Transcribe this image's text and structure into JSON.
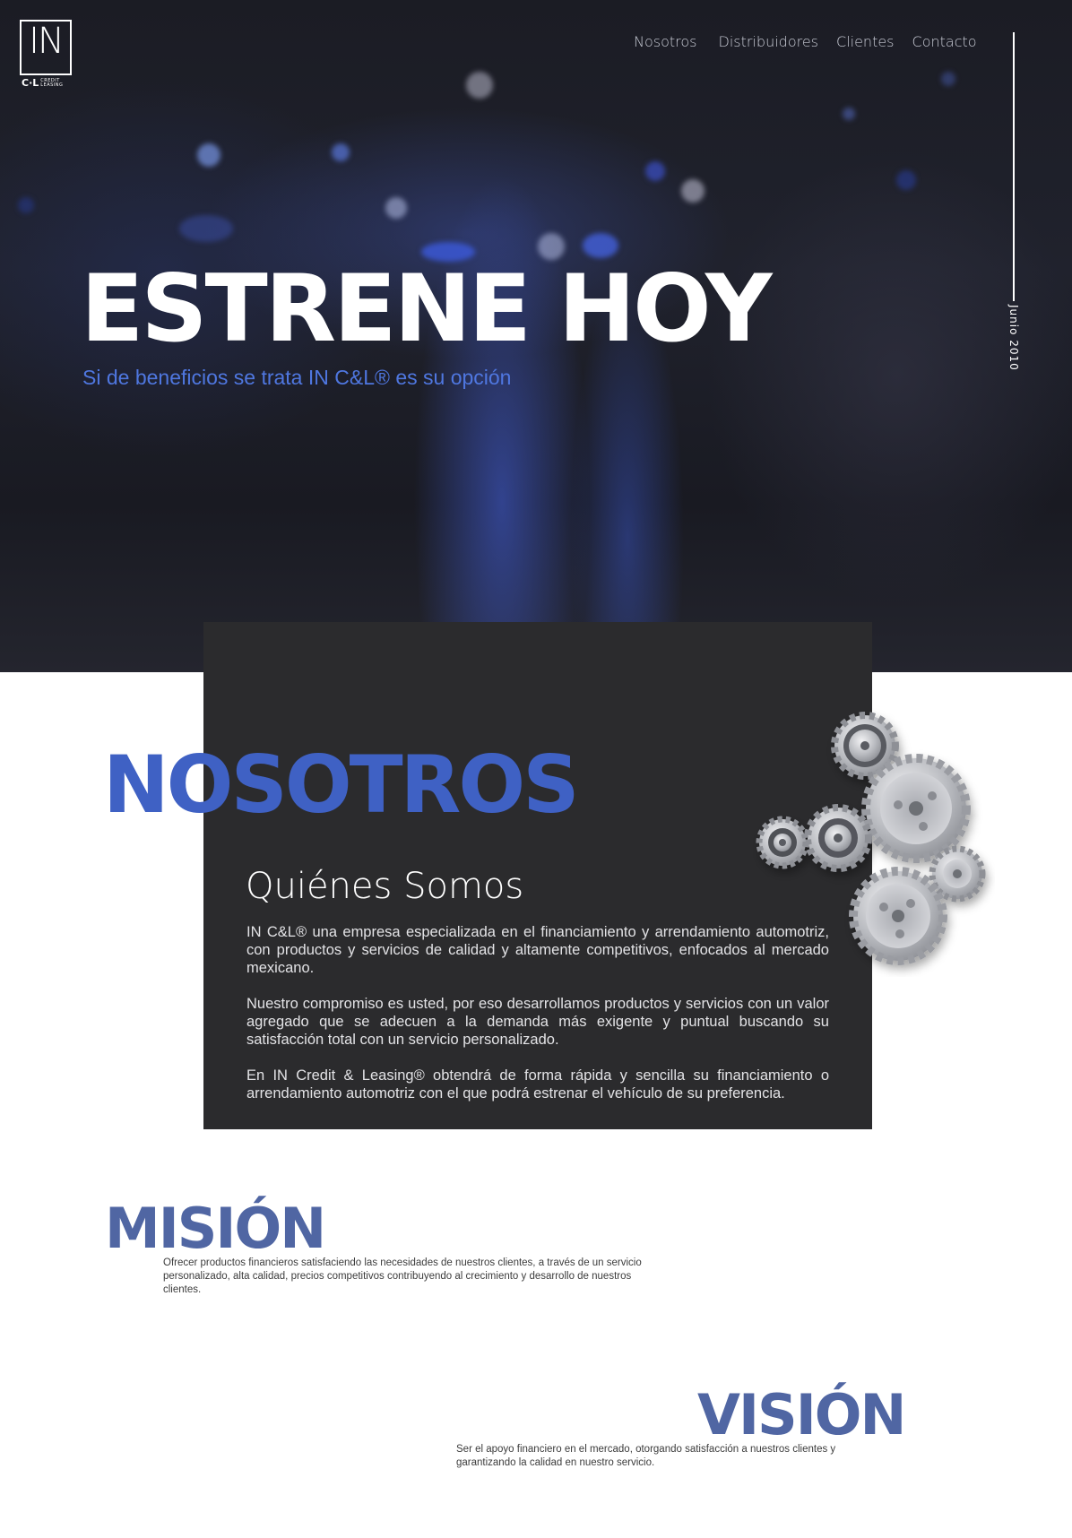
{
  "brand": {
    "logo_main": "IN",
    "logo_cl": "C·L",
    "logo_sub": "CREDIT LEASING"
  },
  "nav": {
    "items": [
      {
        "label": "Nosotros"
      },
      {
        "label": "Distribuidores"
      },
      {
        "label": "Clientes"
      },
      {
        "label": "Contacto"
      }
    ]
  },
  "hero": {
    "title": "ESTRENE HOY",
    "subtitle": "Si de beneficios se trata  IN C&L®  es su opción",
    "date": "Junio 2010"
  },
  "about": {
    "heading": "NOSOTROS",
    "subtitle": "Quiénes Somos",
    "paragraphs": [
      "IN C&L®  una empresa especializada en el financiamiento y arrendamiento automotriz, con productos y servicios de calidad y altamente competitivos, enfocados al mercado mexicano.",
      "Nuestro compromiso es usted, por eso desarrollamos productos y servicios con un valor agregado que se adecuen a la demanda más exigente y puntual buscando su satisfacción total con un servicio personalizado.",
      "En IN Credit & Leasing® obtendrá de forma rápida y sencilla su financiamiento o arrendamiento automotriz con el que podrá estrenar el vehículo de su preferencia."
    ]
  },
  "mision": {
    "heading": "MISIÓN",
    "text": "Ofrecer productos financieros satisfaciendo las necesidades de nuestros clientes, a través de un servicio personalizado, alta calidad, precios competitivos contribuyendo al crecimiento y desarrollo de nuestros clientes."
  },
  "vision": {
    "heading": "VISIÓN",
    "text": "Ser el apoyo financiero en el mercado, otorgando satisfacción a nuestros clientes y garantizando la calidad en nuestro servicio."
  },
  "colors": {
    "accent_blue": "#3f61c4",
    "muted_blue": "#5066a3",
    "card_dark": "#2b2b2d",
    "hero_subtitle": "#4f77e0"
  },
  "icons": [
    "gears-icon"
  ]
}
